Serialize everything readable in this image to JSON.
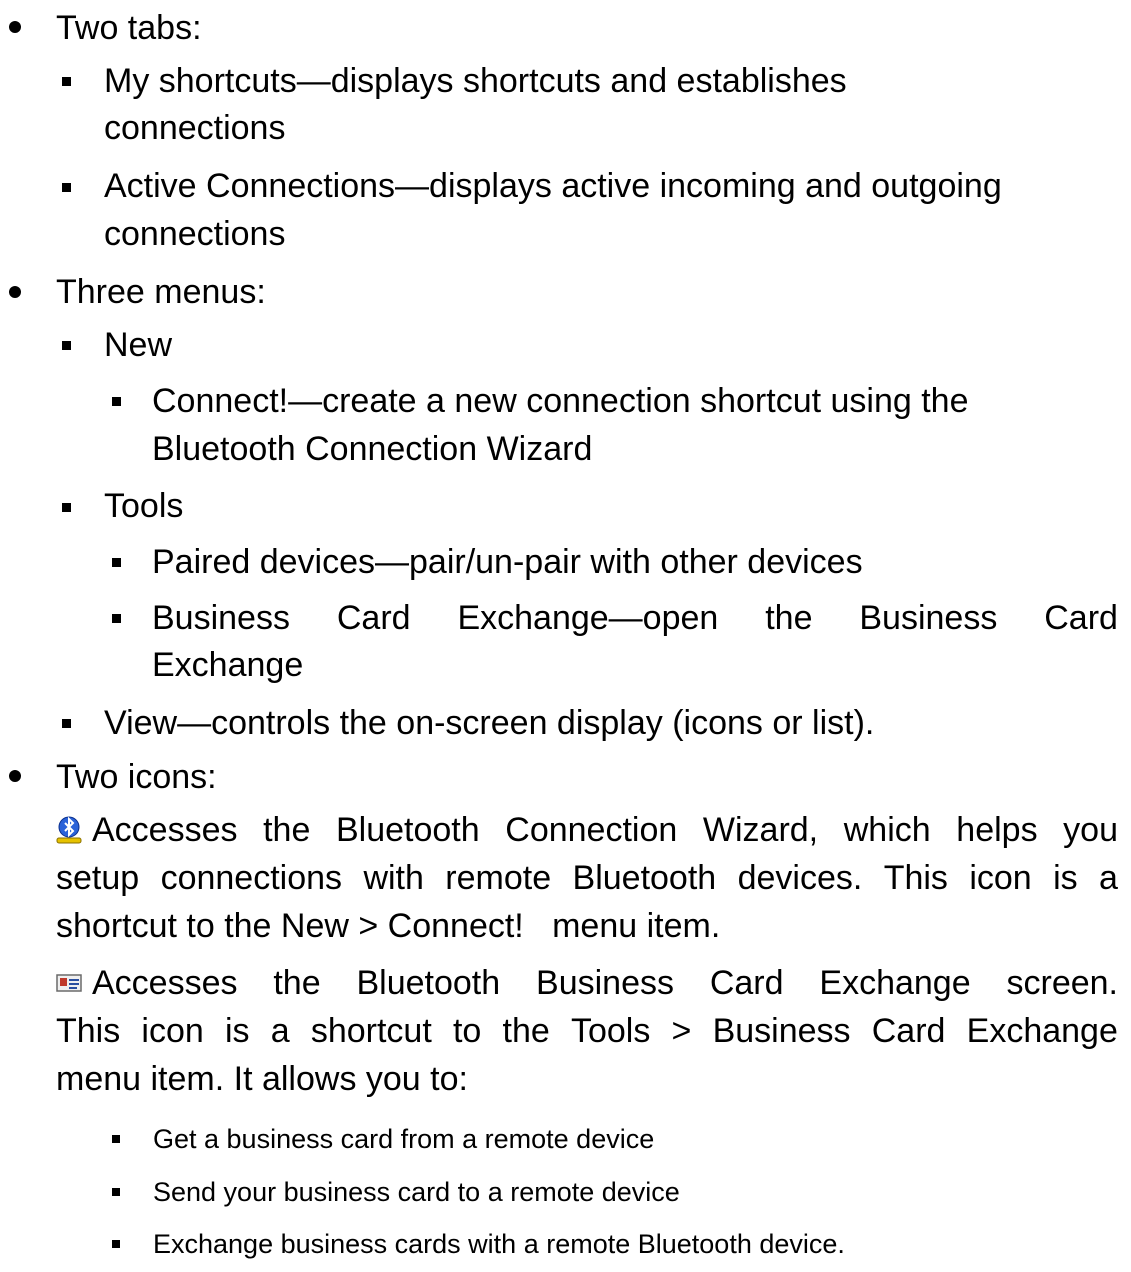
{
  "tabs": {
    "heading": "Two tabs:",
    "my_shortcuts": [
      "My shortcuts—displays shortcuts and establishes",
      "connections"
    ],
    "active_connections": [
      "Active Connections—displays active incoming and outgoing",
      "connections"
    ]
  },
  "menus": {
    "heading": "Three menus:",
    "new_label": "New",
    "connect": [
      "Connect!—create a new connection shortcut using the",
      "Bluetooth Connection Wizard"
    ],
    "tools_label": "Tools",
    "paired": "Paired devices—pair/un-pair with other devices",
    "bce_line1_words": [
      "Business",
      "Card",
      "Exchange—open",
      "the",
      "Business",
      "Card"
    ],
    "bce_line2": "Exchange",
    "view": "View—controls the on-screen display (icons or list)."
  },
  "icons": {
    "heading": "Two icons:",
    "wizard_icon": "bluetooth-wizard-icon",
    "wizard_line1_words": [
      "Accesses",
      "the",
      "Bluetooth",
      "Connection",
      "Wizard,",
      "which",
      "helps",
      "you"
    ],
    "wizard_line2_words": [
      "setup",
      "connections",
      "with",
      "remote",
      "Bluetooth",
      "devices.",
      "This",
      "icon",
      "is",
      "a"
    ],
    "wizard_line3": "shortcut to the New > Connect!   menu item.",
    "card_icon": "business-card-icon",
    "card_line1_words": [
      "Accesses",
      "the",
      "Bluetooth",
      "Business",
      "Card",
      "Exchange",
      "screen."
    ],
    "card_line2_words": [
      "This",
      "icon",
      "is",
      "a",
      "shortcut",
      "to",
      "the",
      "Tools",
      ">",
      "Business",
      "Card",
      "Exchange"
    ],
    "card_line3": "menu item. It allows you to:",
    "abilities": [
      "Get a business card from a remote device",
      "Send your business card to a remote device",
      "Exchange business cards with a remote Bluetooth device."
    ]
  }
}
